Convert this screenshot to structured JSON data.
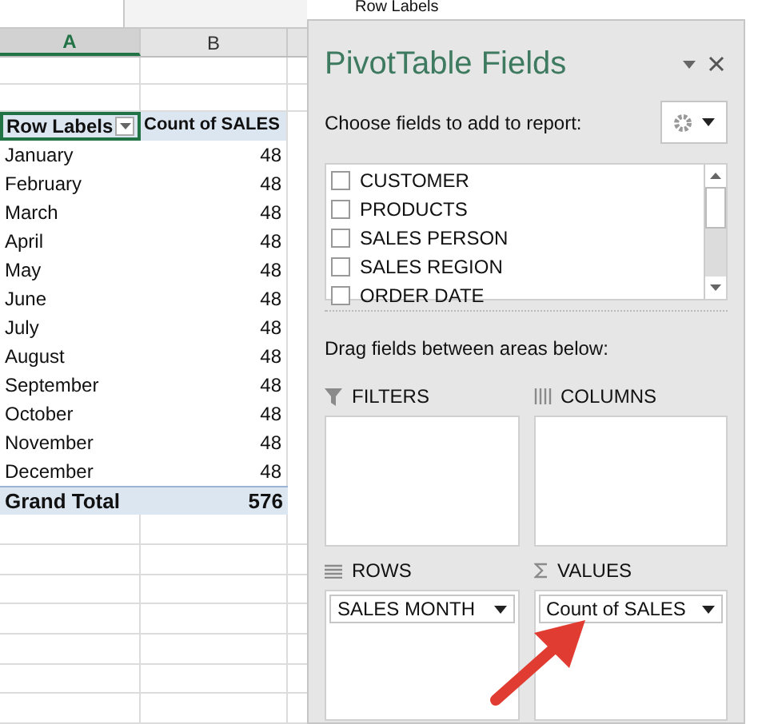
{
  "formula_bar": {
    "value": "Row Labels"
  },
  "columns": [
    {
      "label": "A",
      "selected": true
    },
    {
      "label": "B",
      "selected": false
    }
  ],
  "pivot": {
    "header": {
      "label": "Row Labels",
      "value": "Count of SALES"
    },
    "rows": [
      {
        "label": "January",
        "value": "48"
      },
      {
        "label": "February",
        "value": "48"
      },
      {
        "label": "March",
        "value": "48"
      },
      {
        "label": "April",
        "value": "48"
      },
      {
        "label": "May",
        "value": "48"
      },
      {
        "label": "June",
        "value": "48"
      },
      {
        "label": "July",
        "value": "48"
      },
      {
        "label": "August",
        "value": "48"
      },
      {
        "label": "September",
        "value": "48"
      },
      {
        "label": "October",
        "value": "48"
      },
      {
        "label": "November",
        "value": "48"
      },
      {
        "label": "December",
        "value": "48"
      }
    ],
    "total": {
      "label": "Grand Total",
      "value": "576"
    }
  },
  "panel": {
    "title": "PivotTable Fields",
    "prompt": "Choose fields to add to report:",
    "fields": [
      {
        "label": "CUSTOMER",
        "checked": false
      },
      {
        "label": "PRODUCTS",
        "checked": false
      },
      {
        "label": "SALES PERSON",
        "checked": false
      },
      {
        "label": "SALES REGION",
        "checked": false
      },
      {
        "label": "ORDER DATE",
        "checked": false
      }
    ],
    "areas_hint": "Drag fields between areas below:",
    "areas": [
      {
        "kind": "filter",
        "label": "FILTERS"
      },
      {
        "kind": "columns",
        "label": "COLUMNS"
      },
      {
        "kind": "rows",
        "label": "ROWS",
        "items": [
          "SALES MONTH"
        ]
      },
      {
        "kind": "values",
        "label": "VALUES",
        "items": [
          "Count of SALES"
        ]
      }
    ]
  }
}
